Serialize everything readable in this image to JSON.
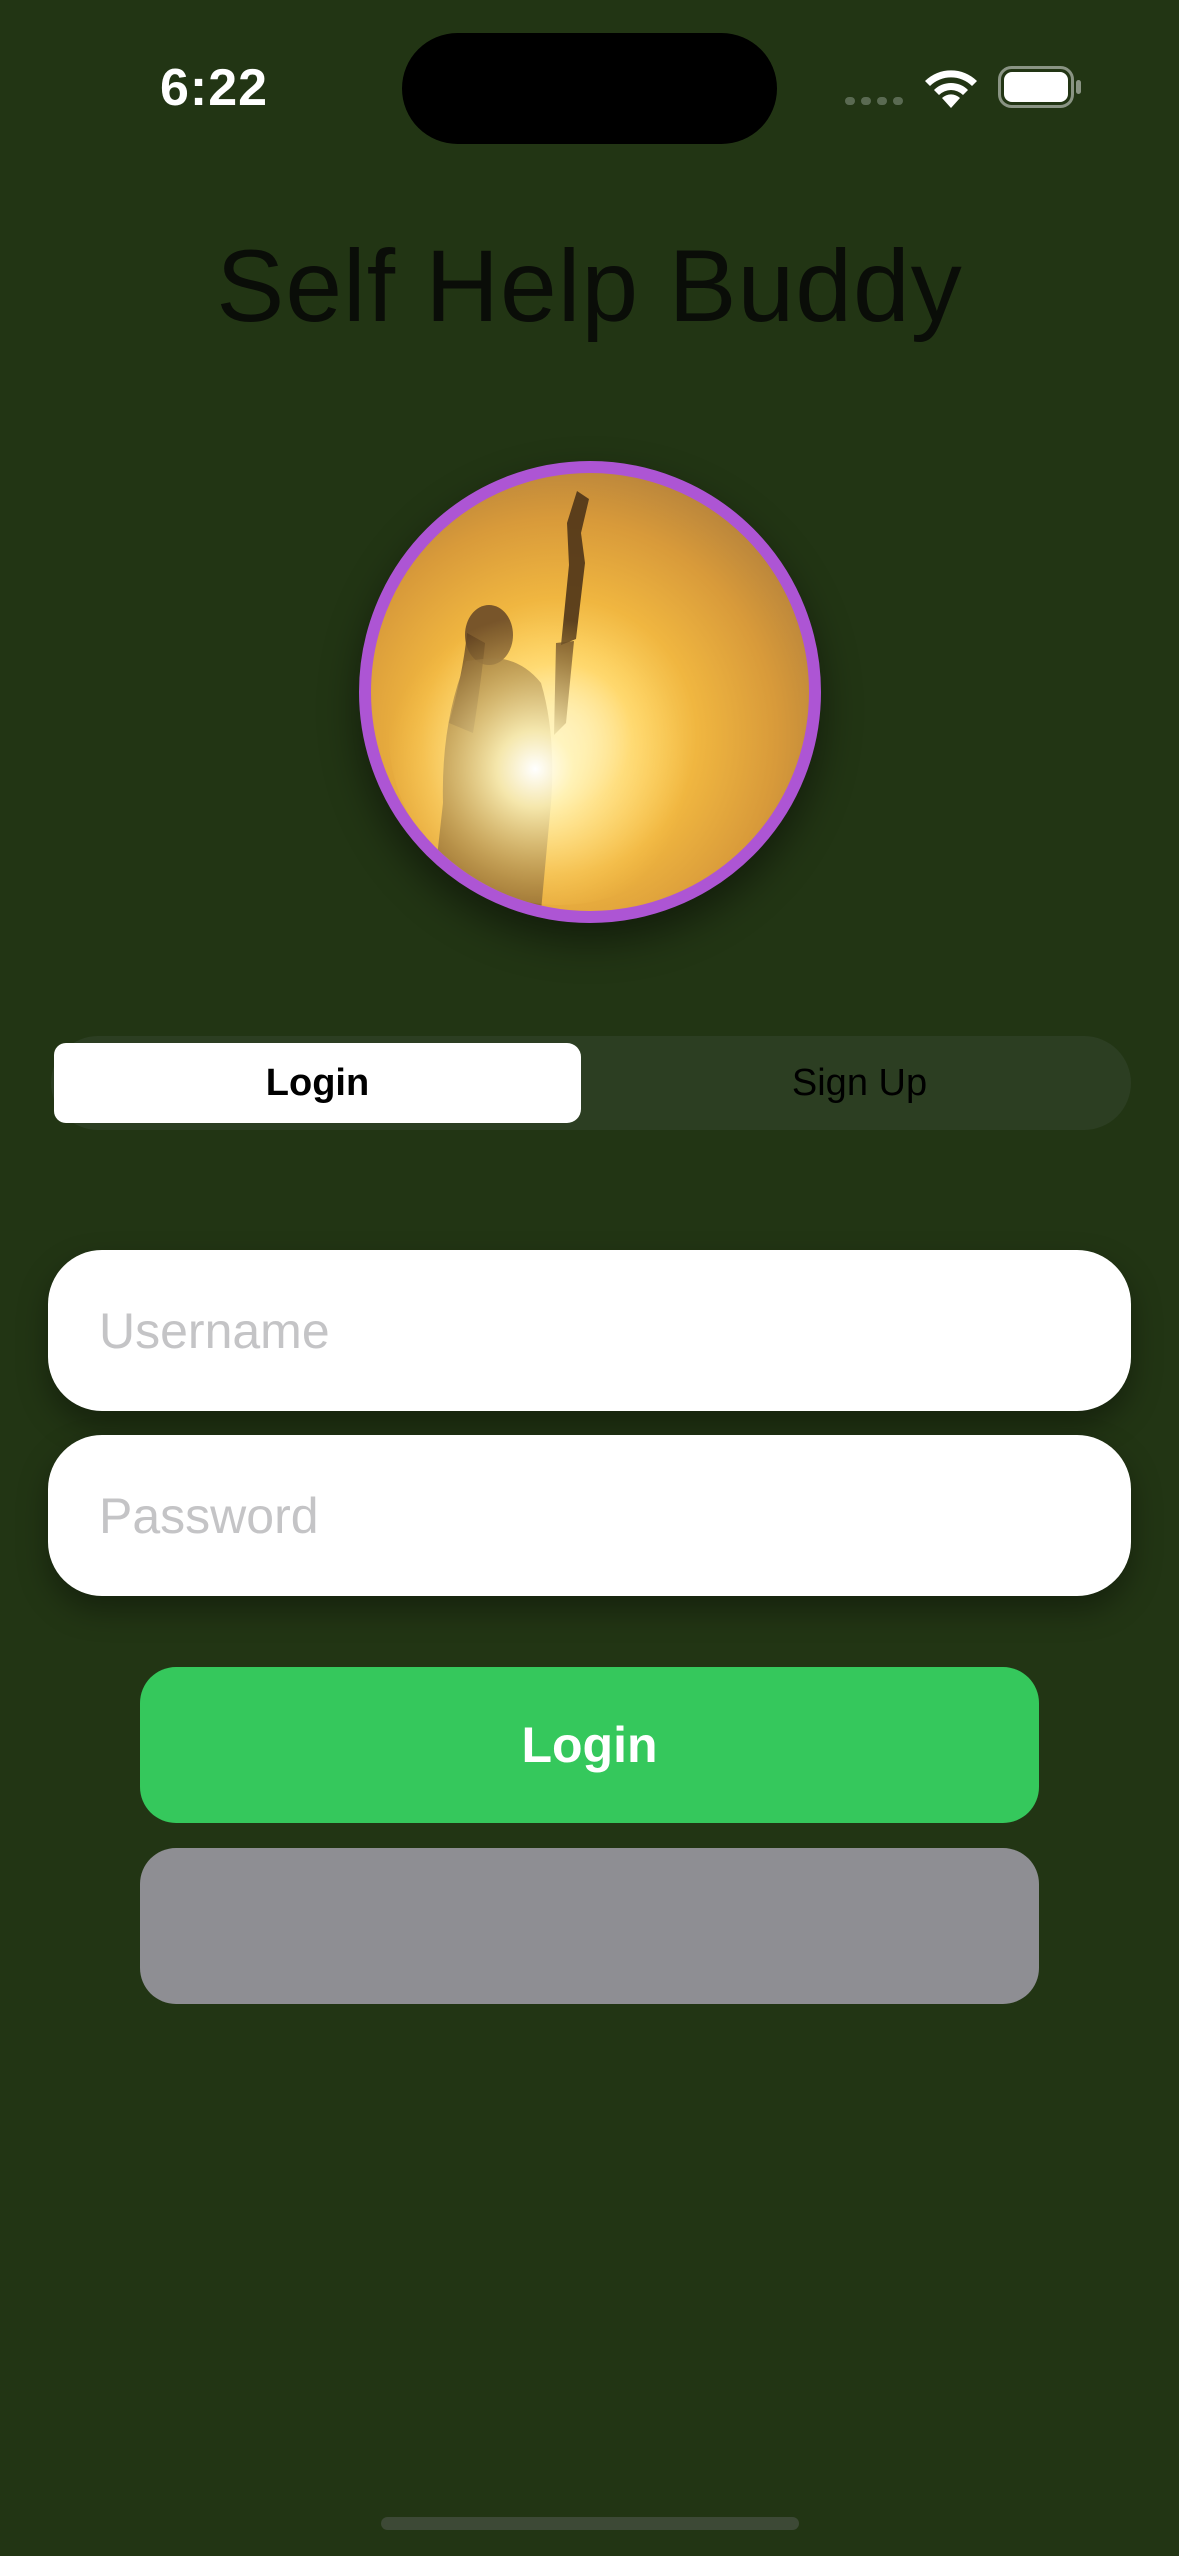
{
  "status_bar": {
    "time": "6:22"
  },
  "app": {
    "title": "Self Help Buddy"
  },
  "segmented_control": {
    "options": [
      {
        "label": "Login",
        "selected": true
      },
      {
        "label": "Sign Up",
        "selected": false
      }
    ]
  },
  "form": {
    "username": {
      "value": "",
      "placeholder": "Username"
    },
    "password": {
      "value": "",
      "placeholder": "Password"
    }
  },
  "buttons": {
    "login_label": "Login",
    "secondary_label": ""
  },
  "colors": {
    "background": "#223514",
    "title": "#0a0d08",
    "avatar_border": "#ad55d4",
    "segment_track": "#2c3e22",
    "login_button": "#35c85c",
    "secondary_button": "#8e8e93"
  },
  "icons": {
    "wifi": "wifi-icon",
    "battery": "battery-icon",
    "signal": "cellular-signal-icon"
  }
}
